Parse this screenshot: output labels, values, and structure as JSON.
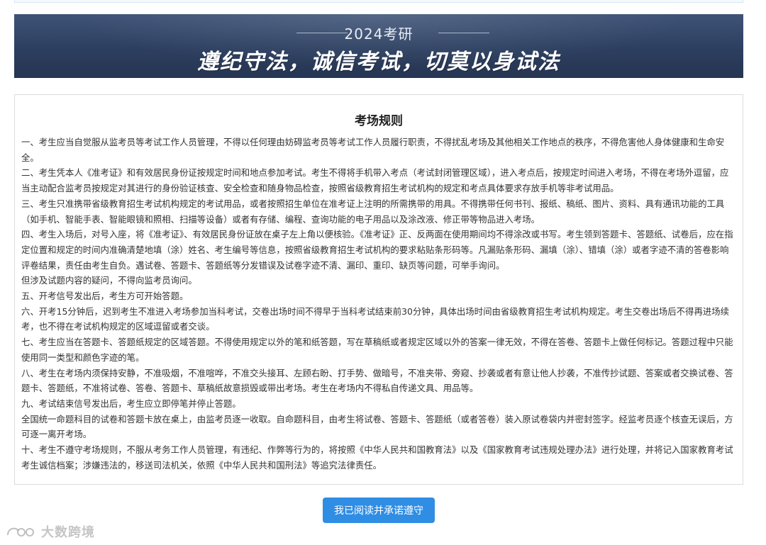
{
  "banner": {
    "subtitle": "2024考研",
    "slogan": "遵纪守法，诚信考试，切莫以身试法"
  },
  "rules": {
    "title": "考场规则",
    "items": [
      "一、考生应当自觉服从监考员等考试工作人员管理，不得以任何理由妨碍监考员等考试工作人员履行职责，不得扰乱考场及其他相关工作地点的秩序，不得危害他人身体健康和生命安全。",
      "二、考生凭本人《准考证》和有效居民身份证按规定时间和地点参加考试。考生不得将手机带入考点（考试封闭管理区域），进入考点后，按规定时间进入考场，不得在考场外逗留，应当主动配合监考员按规定对其进行的身份验证核查、安全检查和随身物品检查，按照省级教育招生考试机构的规定和考点具体要求存放手机等非考试用品。",
      "三、考生只准携带省级教育招生考试机构规定的考试用品，或者按照招生单位在准考证上注明的所需携带的用具。不得携带任何书刊、报纸、稿纸、图片、资料、具有通讯功能的工具（如手机、智能手表、智能眼镜和照相、扫描等设备）或者有存储、编程、查询功能的电子用品以及涂改液、修正带等物品进入考场。",
      "四、考生入场后，对号入座，将《准考证》、有效居民身份证放在桌子左上角以便核验。《准考证》正、反两面在使用期间均不得涂改或书写。考生领到答题卡、答题纸、试卷后，应在指定位置和规定的时间内准确清楚地填（涂）姓名、考生编号等信息，按照省级教育招生考试机构的要求粘贴条形码等。凡漏贴条形码、漏填（涂）、错填（涂）或者字迹不清的答卷影响评卷结果，责任由考生自负。遇试卷、答题卡、答题纸等分发错误及试卷字迹不清、漏印、重印、缺页等问题，可举手询问。",
      "但涉及试题内容的疑问，不得向监考员询问。",
      "五、开考信号发出后，考生方可开始答题。",
      "六、开考15分钟后，迟到考生不准进入考场参加当科考试，交卷出场时间不得早于当科考试结束前30分钟，具体出场时间由省级教育招生考试机构规定。考生交卷出场后不得再进场续考，也不得在考试机构规定的区域逗留或者交谈。",
      "七、考生应当在答题卡、答题纸规定的区域答题。不得使用规定以外的笔和纸答题，写在草稿纸或者规定区域以外的答案一律无效，不得在答卷、答题卡上做任何标记。答题过程中只能使用同一类型和颜色字迹的笔。",
      "八、考生在考场内须保持安静，不准吸烟，不准喧哗，不准交头接耳、左顾右盼、打手势、做暗号，不准夹带、旁窥、抄袭或者有意让他人抄袭，不准传抄试题、答案或者交换试卷、答题卡、答题纸，不准将试卷、答卷、答题卡、草稿纸故意损毁或带出考场。考生在考场内不得私自传递文具、用品等。",
      "九、考试结束信号发出后，考生应立即停笔并停止答题。",
      "全国统一命题科目的试卷和答题卡放在桌上，由监考员逐一收取。自命题科目，由考生将试卷、答题卡、答题纸（或者答卷）装入原试卷袋内并密封签字。经监考员逐个核查无误后，方可逐一离开考场。",
      "十、考生不遵守考场规则，不服从考务工作人员管理，有违纪、作弊等行为的，将按照《中华人民共和国教育法》以及《国家教育考试违规处理办法》进行处理，并将记入国家教育考试考生诚信档案；涉嫌违法的，移送司法机关，依照《中华人民共和国刑法》等追究法律责任。"
    ]
  },
  "agree_button": {
    "label": "我已阅读并承诺遵守"
  },
  "watermark": {
    "text": "大数跨境"
  },
  "colors": {
    "banner_bg": "#2d3f60",
    "button_bg": "#2f8de4",
    "border": "#dcdcdc"
  }
}
